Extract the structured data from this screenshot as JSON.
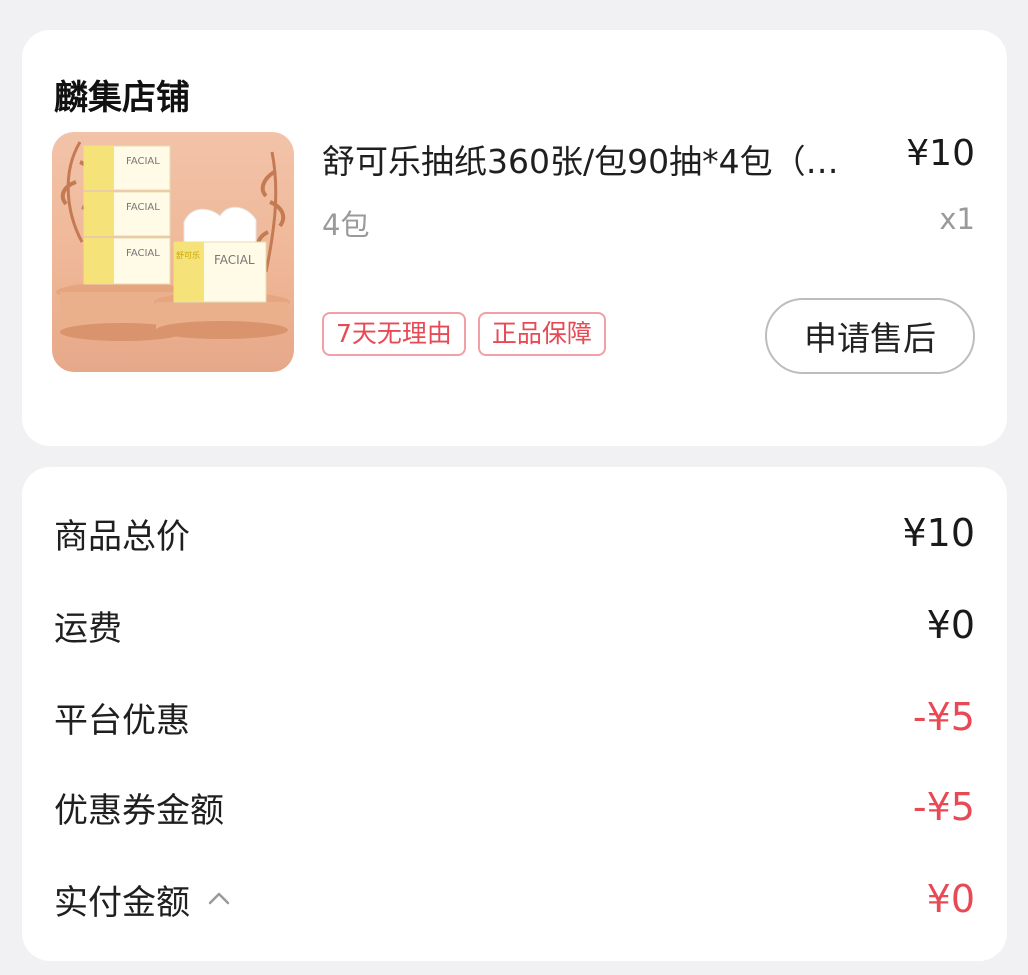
{
  "store": {
    "name": "麟集店铺"
  },
  "product": {
    "image_box_label": "FACIAL",
    "image_brand": "舒可乐",
    "title": "舒可乐抽纸360张/包90抽*4包（…",
    "price": "¥10",
    "spec": "4包",
    "quantity": "x1",
    "tags": [
      "7天无理由",
      "正品保障"
    ],
    "after_sale_label": "申请售后"
  },
  "summary": {
    "rows": [
      {
        "label": "商品总价",
        "value": "¥10"
      },
      {
        "label": "运费",
        "value": "¥0"
      },
      {
        "label": "平台优惠",
        "value": "-¥5"
      },
      {
        "label": "优惠券金额",
        "value": "-¥5"
      },
      {
        "label": "实付金额",
        "value": "¥0"
      }
    ]
  },
  "colors": {
    "accent_red": "#e84a55",
    "page_bg": "#f1f1f3",
    "card_bg": "#ffffff",
    "muted_text": "#9a9a9a"
  },
  "icons": {
    "collapse": "chevron-up-icon"
  }
}
